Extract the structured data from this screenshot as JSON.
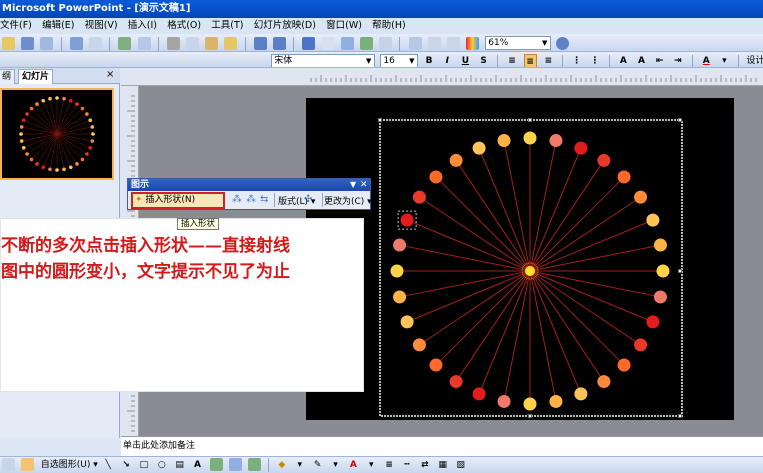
{
  "window": {
    "title": "Microsoft PowerPoint - [演示文稿1]"
  },
  "menu": [
    "文件(F)",
    "编辑(E)",
    "视图(V)",
    "插入(I)",
    "格式(O)",
    "工具(T)",
    "幻灯片放映(D)",
    "窗口(W)",
    "帮助(H)"
  ],
  "standard_toolbar": {
    "zoom": "61%"
  },
  "format_toolbar": {
    "font": "宋体",
    "size": "16",
    "bold": "B",
    "italic": "I",
    "underline": "U",
    "shadow": "S",
    "design_button": "设计(S)"
  },
  "slide_panel": {
    "tab_outline": "纲",
    "tab_slides": "幻灯片",
    "close": "×",
    "thumb_number": "1"
  },
  "diagram_toolbar": {
    "title": "图示",
    "insert_shape": "插入形状(N)",
    "layout": "版式(L)",
    "change_to": "更改为(C)"
  },
  "tooltip": "插入形状",
  "annotation": {
    "line1": "不断的多次点击插入形状——直接射线",
    "line2": "图中的圆形变小，文字提示不见了为止"
  },
  "notes": {
    "placeholder": "单击此处添加备注"
  },
  "draw_toolbar": {
    "autoshapes": "自选图形(U)"
  },
  "colors": {
    "accent_red": "#d31a1a",
    "title_blue": "#0a5bd8"
  }
}
